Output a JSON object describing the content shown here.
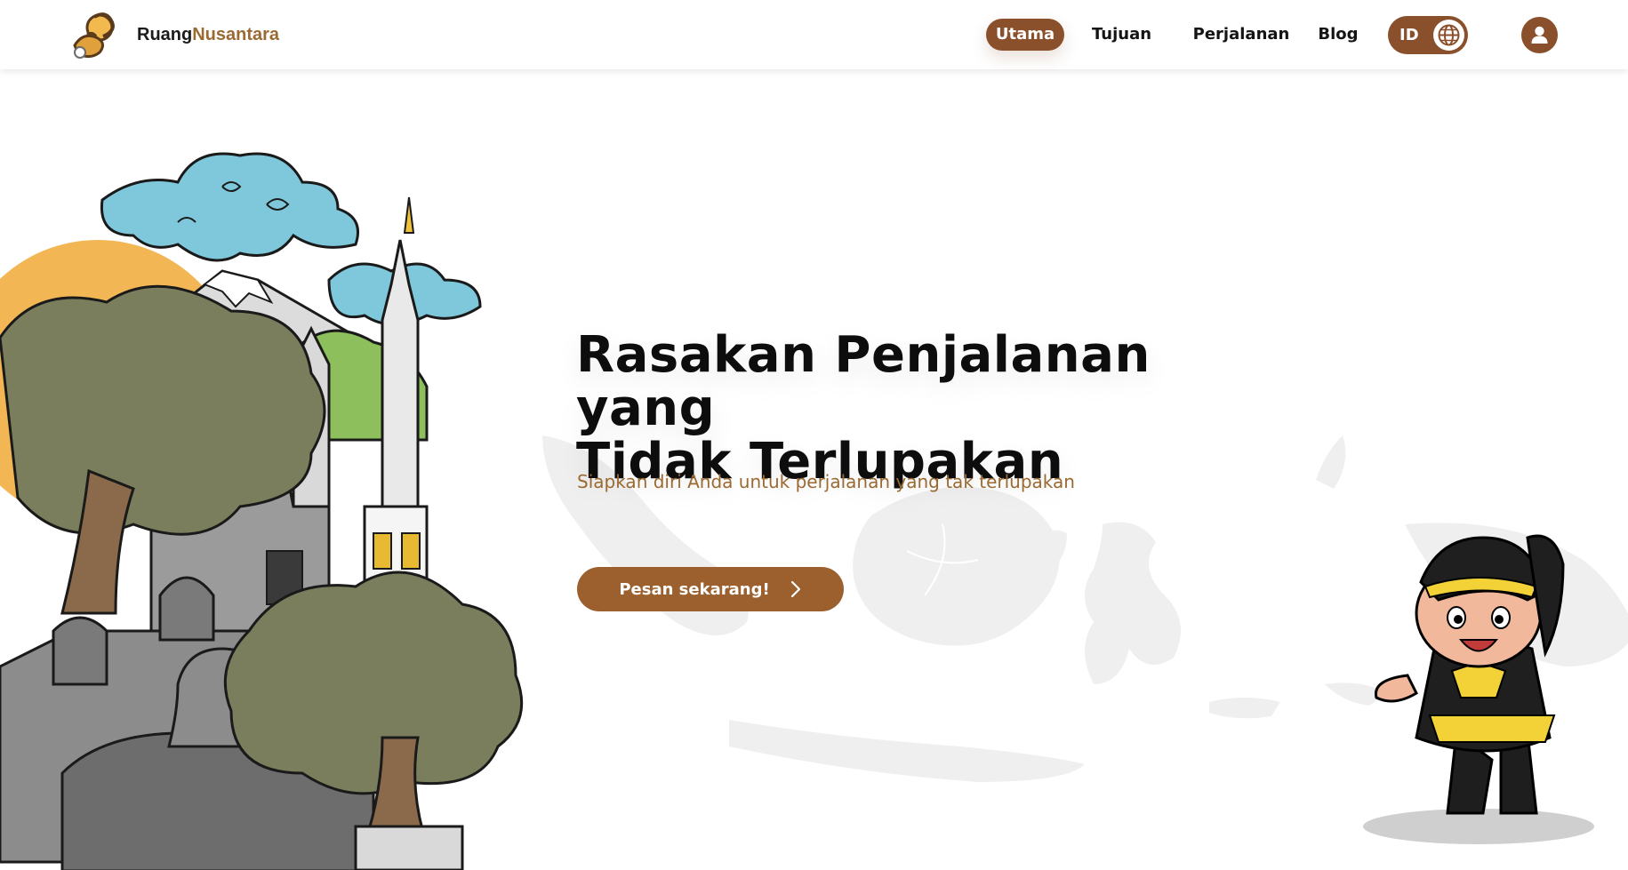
{
  "brand": {
    "name_part1": "Ruang",
    "name_part2": "Nusantara",
    "accent_color": "#9a6a32"
  },
  "nav": {
    "items": [
      {
        "label": "Utama",
        "active": true
      },
      {
        "label": "Tujuan",
        "active": false
      },
      {
        "label": "Perjalanan",
        "active": false
      },
      {
        "label": "Blog",
        "active": false
      }
    ],
    "language": {
      "code": "ID",
      "icon": "globe-icon"
    },
    "user_icon": "user-icon"
  },
  "hero": {
    "title_line1": "Rasakan Penjalanan yang",
    "title_line2": "Tidak Terlupakan",
    "subtitle": "Siapkan diri Anda untuk perjalanan yang tak terlupakan",
    "cta_label": "Pesan sekarang!",
    "cta_icon": "chevron-right-icon"
  },
  "colors": {
    "primary": "#8a4f2b",
    "cta": "#9b602e",
    "subtitle": "#9a6a32",
    "title": "#0d0d0d"
  }
}
